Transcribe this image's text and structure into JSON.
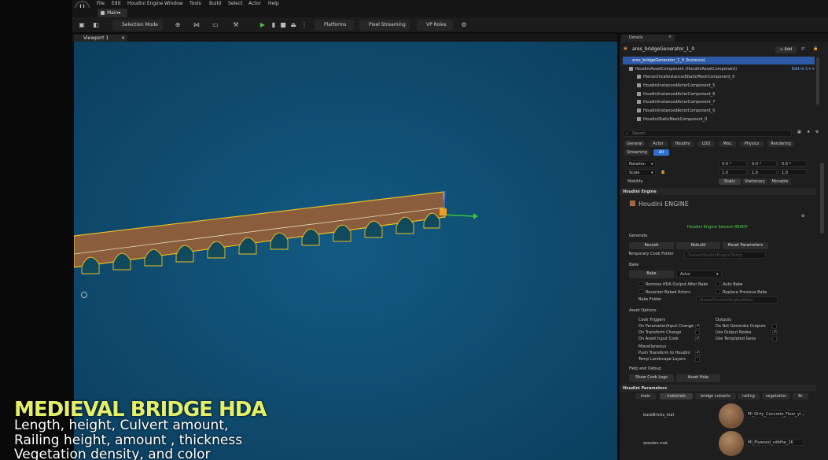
{
  "menubar": {
    "items": [
      "File",
      "Edit",
      "Houdini Engine",
      "Window",
      "Tools",
      "Build",
      "Select",
      "Actor",
      "Help"
    ],
    "tab_label": "Main▾"
  },
  "toolbar": {
    "selection_mode": "Selection Mode",
    "platforms": "Platforms",
    "pixel_streaming": "Pixel Streaming",
    "vp_roles": "VP Roles"
  },
  "viewport": {
    "tab_label": "Viewport 1",
    "water_color": "#0f4a6e",
    "bridge_color": "#8a5e3c",
    "selection_color": "#f0c020"
  },
  "details": {
    "tab_label": "Details",
    "actor_name": "ares_bridgeGenerator_1_0",
    "add_label": "+ Add",
    "instance_row": "ares_bridgeGenerator_1_0 (Instance)",
    "component_row": "HoudiniAssetComponent (HoudiniAssetComponent)",
    "edit_in_cpp": "Edit in C++",
    "tree_items": [
      "HierarchicalInstancedStaticMeshComponent_0",
      "HoudiniInstancedActorComponent_5",
      "HoudiniInstancedActorComponent_6",
      "HoudiniInstancedActorComponent_7",
      "HoudiniInstancedActorComponent_0",
      "HoudiniStaticMeshComponent_0"
    ],
    "search_placeholder": "Search",
    "filter_tabs": [
      "General",
      "Actor",
      "Houdini",
      "LOD",
      "Misc",
      "Physics",
      "Rendering"
    ],
    "filter_tabs2": [
      "Streaming",
      "All"
    ],
    "transform": {
      "rotation_label": "Rotation",
      "scale_label": "Scale",
      "mobility_label": "Mobility",
      "rotation_values": [
        "0.0 °",
        "0.0 °",
        "0.0 °"
      ],
      "scale_values": [
        "1.0",
        "1.0",
        "1.0"
      ],
      "mobility_options": [
        "Static",
        "Stationary",
        "Movable"
      ]
    },
    "houdini_engine": {
      "section": "Houdini Engine",
      "logo_text": "Houdini ENGINE",
      "status": "Houdini Engine Session READY",
      "generate": "Generate",
      "recook": "Recook",
      "rebuild": "Rebuild",
      "reset_parameters": "Reset Parameters",
      "temp_cook_folder": "Temporary Cook Folder",
      "temp_cook_placeholder": "/Game/HoudiniEngine/Temp",
      "bake": "Bake",
      "bake_button": "Bake",
      "bake_type": "Actor",
      "remove_hda": "Remove HDA Output After Bake",
      "auto_bake": "Auto Bake",
      "recenter": "Recenter Baked Actors",
      "replace_prev": "Replace Previous Bake",
      "bake_folder": "Bake Folder",
      "bake_folder_placeholder": "/Game/HoudiniEngine/Bake",
      "asset_options": "Asset Options",
      "cook_triggers": "Cook Triggers",
      "outputs": "Outputs",
      "on_param": "On Parameter/Input Change",
      "on_transform": "On Transform Change",
      "on_asset_input": "On Asset Input Cook",
      "do_not_generate": "Do Not Generate Outputs",
      "use_output_nodes": "Use Output Nodes",
      "use_templated": "Use Templated Geos",
      "misc": "Miscellaneous",
      "push_transform": "Push Transform to Houdini",
      "temp_landscape": "Temp Landscape Layers",
      "help_debug": "Help and Debug",
      "show_cook_logs": "Show Cook Logs",
      "asset_help": "Asset Help"
    },
    "houdini_parameters": {
      "section": "Houdini Parameters",
      "tabs": [
        "main",
        "materials",
        "bridge culverts",
        "railing",
        "vegetation",
        "Br"
      ],
      "materials": [
        {
          "label": "baseBricks_mat",
          "value": "MI_Dirty_Concrete_Floor_yl..."
        },
        {
          "label": "wooden mat",
          "value": "MI_Plywood_vdbfhe_2K"
        }
      ]
    }
  },
  "overlay": {
    "title": "MEDIEVAL BRIDGE HDA",
    "lines": [
      "Length, height, Culvert amount,",
      "Railing height, amount , thickness",
      "Vegetation density, and color"
    ],
    "title_color": "#e4f06a"
  }
}
